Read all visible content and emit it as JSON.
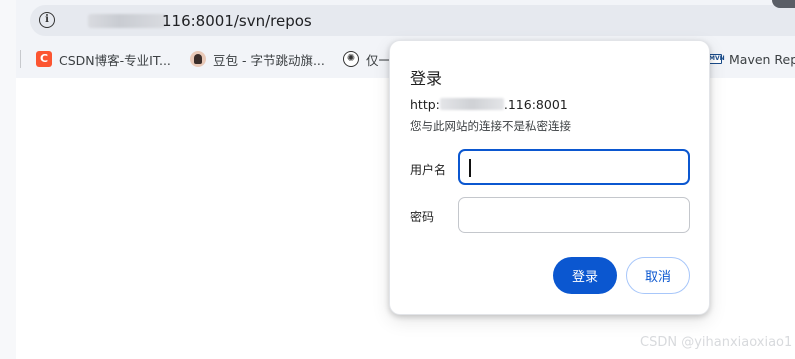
{
  "browser": {
    "url_visible": "116:8001/svn/repos"
  },
  "bookmarks": [
    {
      "label": "CSDN博客-专业IT...",
      "icon": "csdn-icon"
    },
    {
      "label": "豆包 - 字节跳动旗...",
      "icon": "avatar-icon"
    },
    {
      "label": "仅一",
      "icon": "chatgpt-icon"
    },
    {
      "label": "Maven Repo",
      "icon": "maven-icon"
    }
  ],
  "dialog": {
    "title": "登录",
    "host_prefix": "http:",
    "host_suffix": ".116:8001",
    "warning": "您与此网站的连接不是私密连接",
    "username_label": "用户名",
    "username_value": "",
    "password_label": "密码",
    "password_value": "",
    "login_button": "登录",
    "cancel_button": "取消"
  },
  "watermark": "CSDN @yihanxiaoxiao1",
  "colors": {
    "accent": "#0b57d0",
    "csdn": "#fc5531"
  }
}
